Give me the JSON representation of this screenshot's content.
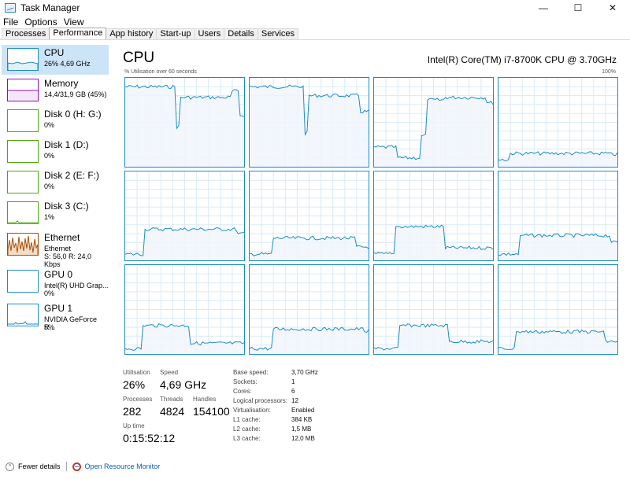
{
  "window": {
    "title": "Task Manager",
    "minimize": "—",
    "maximize": "☐",
    "close": "✕"
  },
  "menu": {
    "file": "File",
    "options": "Options",
    "view": "View"
  },
  "tabs": [
    "Processes",
    "Performance",
    "App history",
    "Start-up",
    "Users",
    "Details",
    "Services"
  ],
  "sidebar": {
    "items": [
      {
        "name": "CPU",
        "sub1": "26% 4,69 GHz",
        "sub2": "",
        "color": "#1a8cc8"
      },
      {
        "name": "Memory",
        "sub1": "14,4/31,9 GB (45%)",
        "sub2": "",
        "color": "#8b12ae"
      },
      {
        "name": "Disk 0 (H: G:)",
        "sub1": "0%",
        "sub2": "",
        "color": "#4da60c"
      },
      {
        "name": "Disk 1 (D:)",
        "sub1": "0%",
        "sub2": "",
        "color": "#4da60c"
      },
      {
        "name": "Disk 2 (E: F:)",
        "sub1": "0%",
        "sub2": "",
        "color": "#4da60c"
      },
      {
        "name": "Disk 3 (C:)",
        "sub1": "1%",
        "sub2": "",
        "color": "#4da60c"
      },
      {
        "name": "Ethernet",
        "sub1": "Ethernet",
        "sub2": "S: 56,0 R: 24,0 Kbps",
        "color": "#a74f01"
      },
      {
        "name": "GPU 0",
        "sub1": "Intel(R) UHD Grap...",
        "sub2": "0%",
        "color": "#1a8cc8"
      },
      {
        "name": "GPU 1",
        "sub1": "NVIDIA GeForce R...",
        "sub2": "5%",
        "color": "#1a8cc8"
      }
    ]
  },
  "main": {
    "title": "CPU",
    "model": "Intel(R) Core(TM) i7-8700K CPU @ 3.70GHz",
    "util_caption": "% Utilisation over 60 seconds",
    "util_max": "100%"
  },
  "stats": {
    "utilisation_label": "Utilisation",
    "utilisation": "26%",
    "speed_label": "Speed",
    "speed": "4,69 GHz",
    "processes_label": "Processes",
    "processes": "282",
    "threads_label": "Threads",
    "threads": "4824",
    "handles_label": "Handles",
    "handles": "154100",
    "uptime_label": "Up time",
    "uptime": "0:15:52:12"
  },
  "specs": [
    {
      "label": "Base speed:",
      "value": "3,70 GHz"
    },
    {
      "label": "Sockets:",
      "value": "1"
    },
    {
      "label": "Cores:",
      "value": "6"
    },
    {
      "label": "Logical processors:",
      "value": "12"
    },
    {
      "label": "Virtualisation:",
      "value": "Enabled"
    },
    {
      "label": "L1 cache:",
      "value": "384 KB"
    },
    {
      "label": "L2 cache:",
      "value": "1,5 MB"
    },
    {
      "label": "L3 cache:",
      "value": "12,0 MB"
    }
  ],
  "footer": {
    "fewer_details": "Fewer details",
    "open_monitor": "Open Resource Monitor"
  },
  "colors": {
    "accent": "#1a8cc8",
    "fill": "#f1f6fb",
    "grid": "#d9eaf7",
    "selection": "#cce4f7"
  }
}
